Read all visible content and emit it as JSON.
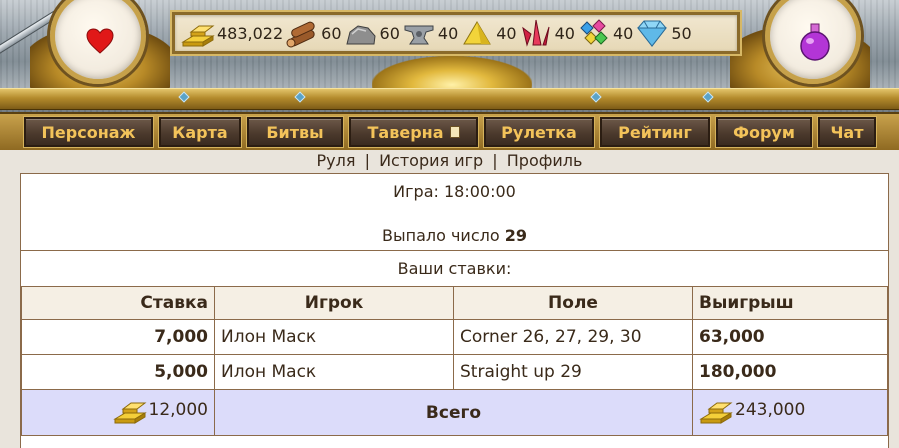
{
  "resources": [
    {
      "icon": "gold-icon",
      "value": "483,022"
    },
    {
      "icon": "wood-icon",
      "value": "60"
    },
    {
      "icon": "stone-icon",
      "value": "60"
    },
    {
      "icon": "anvil-icon",
      "value": "40"
    },
    {
      "icon": "sulfur-icon",
      "value": "40"
    },
    {
      "icon": "crystal-icon",
      "value": "40"
    },
    {
      "icon": "gems-icon",
      "value": "40"
    },
    {
      "icon": "diamond-icon",
      "value": "50"
    }
  ],
  "nav": {
    "character": "Персонаж",
    "map": "Карта",
    "battles": "Битвы",
    "tavern": "Таверна",
    "roulette": "Рулетка",
    "rating": "Рейтинг",
    "forum": "Форум",
    "chat": "Чат"
  },
  "subnav": {
    "roulette": "Руля",
    "history": "История игр",
    "profile": "Профиль",
    "separator": "|"
  },
  "result": {
    "game_time": "Игра: 18:00:00",
    "drawn_label": "Выпало число",
    "drawn_number": "29",
    "your_bets": "Ваши ставки:"
  },
  "table": {
    "headers": {
      "stake": "Ставка",
      "player": "Игрок",
      "field": "Поле",
      "win": "Выигрыш"
    },
    "rows": [
      {
        "stake": "7,000",
        "player": "Илон Маск",
        "field": "Corner 26, 27, 29, 30",
        "win": "63,000"
      },
      {
        "stake": "5,000",
        "player": "Илон Маск",
        "field": "Straight up 29",
        "win": "180,000"
      }
    ],
    "total": {
      "stake": "12,000",
      "label": "Всего",
      "win": "243,000"
    }
  },
  "colors": {
    "nav_text": "#f3c35a",
    "total_row_bg": "#dcdcfa",
    "border": "#8b6a4a"
  }
}
